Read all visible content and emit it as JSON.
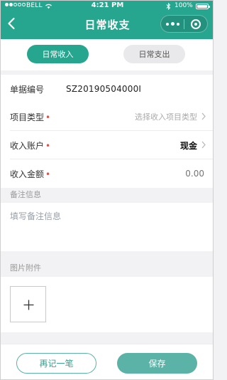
{
  "status_bar": {
    "carrier": "BELL",
    "time": "4:21 PM",
    "battery": "100%"
  },
  "nav": {
    "title": "日常收支",
    "back_icon": "chevron-left-icon",
    "more_icon": "more-dots-icon",
    "close_icon": "target-circle-icon"
  },
  "tabs": [
    {
      "label": "日常收入",
      "active": true
    },
    {
      "label": "日常支出",
      "active": false
    }
  ],
  "form": {
    "doc_number": {
      "label": "单据编号",
      "value": "SZ20190504000I"
    },
    "item_type": {
      "label": "项目类型",
      "required_mark": "•",
      "placeholder": "选择收入项目类型"
    },
    "account": {
      "label": "收入账户",
      "required_mark": "•",
      "value": "现金"
    },
    "amount": {
      "label": "收入金额",
      "required_mark": "•",
      "placeholder": "0.00"
    }
  },
  "notes": {
    "label": "备注信息",
    "placeholder": "填写备注信息"
  },
  "attachments": {
    "label": "图片附件",
    "add_icon": "plus-icon"
  },
  "footer": {
    "again_label": "再记一笔",
    "save_label": "保存"
  },
  "colors": {
    "brand": "#27a68f",
    "button_save": "#5bb3a8",
    "required": "#e84b4b"
  }
}
